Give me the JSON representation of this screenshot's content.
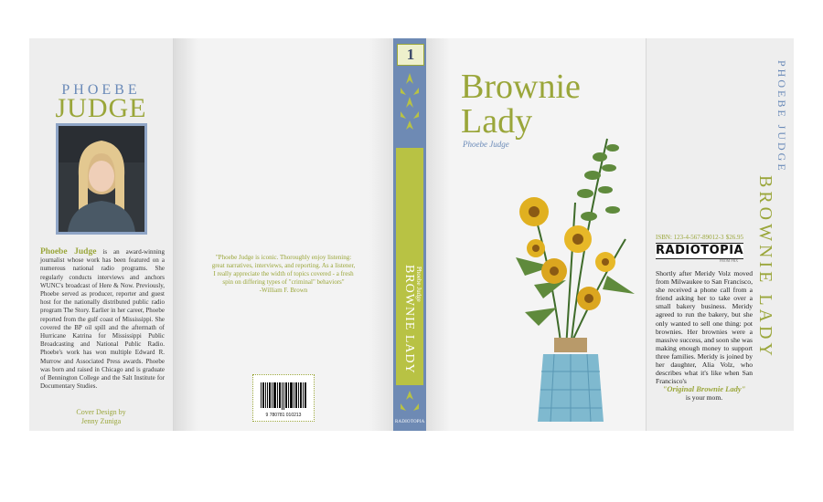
{
  "left_flap": {
    "author_first": "PHOEBE",
    "author_last": "JUDGE",
    "bio_lead": "Phoebe Judge",
    "bio": "is an award-winning journalist whose work has been featured on a numerous national radio programs. She regularly conducts interviews and anchors WUNC's broadcast of Here & Now. Previously, Phoebe served as producer, reporter and guest host for the nationally distributed public radio program The Story. Earlier in her career, Phoebe reported from the gulf coast of Mississippi. She covered the BP oil spill and the aftermath of Hurricane Katrina for Mississippi Public Broadcasting and National Public Radio. Phoebe's work has won multiple Edward R. Murrow and Associated Press awards. Phoebe was born and raised in Chicago and is graduate of Bennington College and the Salt Institute for Documentary Studies.",
    "credit_label": "Cover Design by",
    "credit_name": "Jenny Zuniga"
  },
  "back_cover": {
    "quote": "\"Phoebe Judge is iconic. Thoroughly enjoy listening: great narratives, interviews, and reporting. As a listener, I really appreciate the width of topics covered - a fresh spin on differing types of \"criminal\" behaviors\"",
    "quote_attribution": "-William F. Brown",
    "barcode_number": "9 780781 010213"
  },
  "spine": {
    "number": "1",
    "title": "BROWNIE LADY",
    "author": "Phoebe Judge",
    "isbn": "ISBN: 123-4-567-89012-3",
    "brand": "RADIOTOPIA"
  },
  "front_cover": {
    "title_line1": "Brownie",
    "title_line2": "Lady",
    "author": "Phoebe Judge"
  },
  "right_flap": {
    "isbn": "ISBN: 123-4-567-89012-3",
    "price": "$26.95",
    "publisher": "RADIOTOPIA",
    "publisher_small": "FROM PRX",
    "synopsis": "Shortly after Meridy Volz moved from Milwaukee to San Francisco, she received a phone call from a friend asking her to take over a small bakery business. Meridy agreed to run the bakery, but she only wanted to sell one thing: pot brownies. Her brownies were a massive success, and soon she was making enough money to support three families. Meridy is joined by her daughter, Alia Volz, who describes what it's like when San Francisco's",
    "highlight": "\"Original Brownie Lady\"",
    "closing": "is your mom.",
    "side_title": "BROWNIE LADY",
    "side_author": "PHOEBE JUDGE"
  },
  "colors": {
    "accent_green": "#9aa63a",
    "accent_blue": "#6a8ab8",
    "spine_blue": "#6e8ab4",
    "spine_green": "#b8c244"
  }
}
